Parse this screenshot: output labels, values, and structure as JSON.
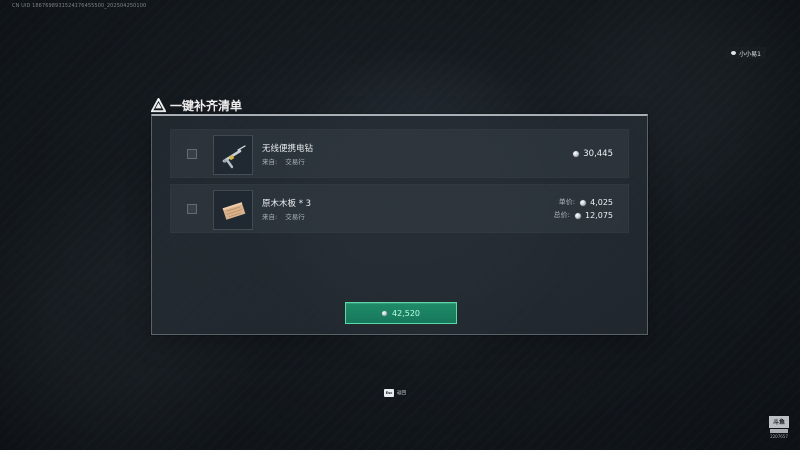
{
  "header": {
    "uid": "CN UID 1867698931524176455500_20250425010​0",
    "user_tag": "小小易1"
  },
  "panel": {
    "title": "一键补齐清单",
    "items": [
      {
        "name": "无线便携电钻",
        "source_label": "来自:",
        "source_value": "交易行",
        "price": "30,445"
      },
      {
        "name": "原木木板 * 3",
        "source_label": "来自:",
        "source_value": "交易行",
        "unit_price_label": "单价:",
        "unit_price": "4,025",
        "total_price_label": "总价:",
        "total_price": "12,075"
      }
    ],
    "buy_total": "42,520"
  },
  "footer": {
    "esc_key": "Esc",
    "esc_action": "返回",
    "watermark_brand": "斗鱼",
    "watermark_id": "2207657"
  },
  "colors": {
    "accent": "#1f8c68",
    "accent_text": "#b8ffe6"
  },
  "icons": {
    "title": "warning-icon",
    "currency": "coin-icon",
    "item_1": "drill-icon",
    "item_2": "wood-planks-icon",
    "user": "user-dot-icon"
  }
}
